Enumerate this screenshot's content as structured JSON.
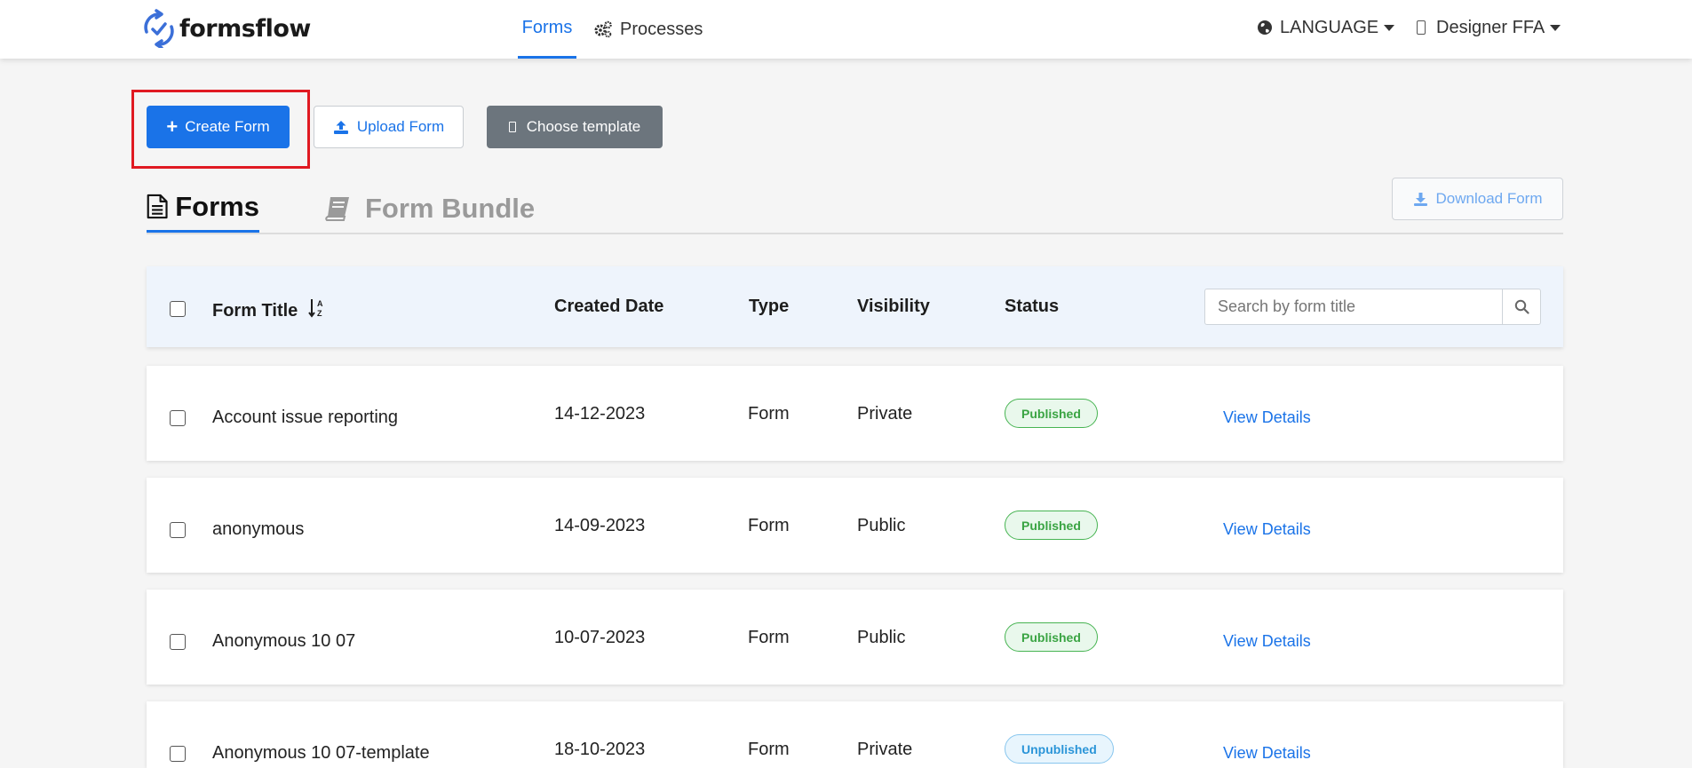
{
  "brand": {
    "name": "formsflow",
    "accent": "#1a73e8"
  },
  "nav": {
    "forms_label": "Forms",
    "processes_label": "Processes",
    "language_label": "LANGUAGE",
    "user_label": "Designer FFA"
  },
  "actions": {
    "create_label": "Create Form",
    "upload_label": "Upload Form",
    "template_label": "Choose template",
    "download_label": "Download Form"
  },
  "tabs": [
    {
      "label": "Forms",
      "active": true
    },
    {
      "label": "Form Bundle",
      "active": false
    }
  ],
  "table": {
    "headers": {
      "title": "Form Title",
      "created": "Created Date",
      "type": "Type",
      "visibility": "Visibility",
      "status": "Status"
    },
    "search_placeholder": "Search by form title",
    "view_label": "View Details",
    "rows": [
      {
        "title": "Account issue reporting",
        "created": "14-12-2023",
        "type": "Form",
        "visibility": "Private",
        "status": "Published"
      },
      {
        "title": "anonymous",
        "created": "14-09-2023",
        "type": "Form",
        "visibility": "Public",
        "status": "Published"
      },
      {
        "title": "Anonymous 10 07",
        "created": "10-07-2023",
        "type": "Form",
        "visibility": "Public",
        "status": "Published"
      },
      {
        "title": "Anonymous 10 07-template",
        "created": "18-10-2023",
        "type": "Form",
        "visibility": "Private",
        "status": "Unpublished"
      }
    ]
  },
  "colors": {
    "primary": "#1a73e8",
    "secondary": "#6c757d",
    "published": "#47b452",
    "unpublished": "#2b95d8",
    "highlight": "#e01a22"
  }
}
